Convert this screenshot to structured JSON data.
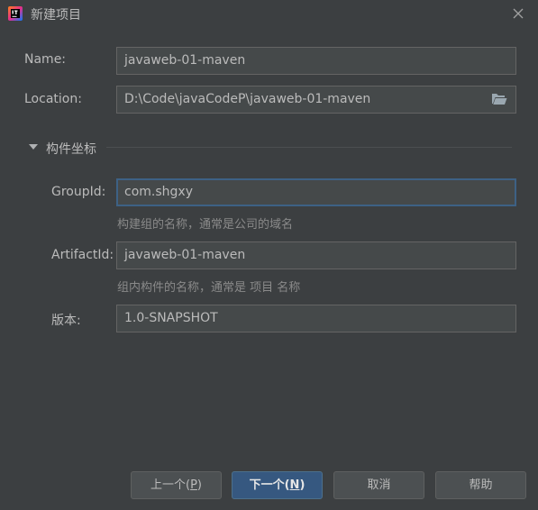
{
  "window": {
    "title": "新建项目"
  },
  "form": {
    "name_label": "Name:",
    "name_value": "javaweb-01-maven",
    "location_label": "Location:",
    "location_value": "D:\\Code\\javaCodeP\\javaweb-01-maven"
  },
  "section": {
    "title": "构件坐标",
    "expanded": true
  },
  "coords": {
    "groupid_label": "GroupId:",
    "groupid_value": "com.shgxy",
    "groupid_hint": "构建组的名称，通常是公司的域名",
    "artifactid_label": "ArtifactId:",
    "artifactid_value": "javaweb-01-maven",
    "artifactid_hint": "组内构件的名称，通常是 项目 名称",
    "version_label": "版本:",
    "version_value": "1.0-SNAPSHOT"
  },
  "buttons": {
    "prev_text": "上一个(",
    "prev_mnemonic": "P",
    "prev_close": ")",
    "next_text": "下一个(",
    "next_mnemonic": "N",
    "next_close": ")",
    "cancel": "取消",
    "help": "帮助"
  },
  "icons": {
    "app": "intellij-idea-icon",
    "close": "close-icon",
    "folder": "folder-open-icon",
    "toggle": "triangle-down-icon"
  },
  "colors": {
    "background": "#3c3f41",
    "field_bg": "#45494a",
    "focus_border": "#3d6185",
    "primary_button": "#365880",
    "hint_text": "#8a8a8a"
  }
}
